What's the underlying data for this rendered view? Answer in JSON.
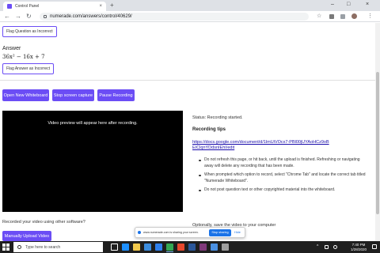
{
  "browser": {
    "tab_title": "Control Panel",
    "tab_close": "×",
    "new_tab": "+",
    "url": "numerade.com/answers/control/40629/",
    "window_controls": {
      "minimize": "–",
      "maximize": "□",
      "close": "×"
    },
    "nav": {
      "back": "←",
      "forward": "→",
      "reload": "↻"
    },
    "toolbar_icons": {
      "star": "☆",
      "menu": "⋮"
    }
  },
  "page": {
    "flag_question_label": "Flag Question as Incorrect",
    "answer_heading": "Answer",
    "answer_equation": "36x² − 16x + 7",
    "flag_answer_label": "Flag Answer as Incorrect",
    "buttons": {
      "open_whiteboard": "Open New Whiteboard",
      "stop_capture": "Stop screen capture",
      "pause_recording": "Pause Recording"
    },
    "video_placeholder": "Video preview will appear here after recording.",
    "status": "Status: Recording started.",
    "tips_heading": "Recording tips",
    "tips_link": "https://docs.google.com/document/d/1lmUiVOcx7-PBl00jUYAoHCz9oBEIClqnYDdsnIEhI/edit",
    "tips": [
      "Do not refresh this page, or hit back, until the upload is finished. Refreshing or navigating away will delete any recording that has been made.",
      "When prompted which option to record, select \"Chrome Tab\" and locate the correct tab titled \"Numerade Whiteboard\".",
      "Do not post question text or other copyrighted material into the whiteboard."
    ],
    "optional_save": "Optionally, save the video to your computer",
    "other_software_label": "Recorded your video using other software?",
    "manual_upload": "Manually Upload Video"
  },
  "share_bar": {
    "text": "www.numerade.com is sharing your screen.",
    "stop": "Stop sharing",
    "hide": "Hide"
  },
  "taskbar": {
    "search_placeholder": "Type here to search",
    "tray_caret": "^",
    "time": "7:40 PM",
    "date": "1/28/2020",
    "apps": [
      {
        "name": "task-view",
        "color": "#ffffff"
      },
      {
        "name": "edge",
        "color": "#1e90ff"
      },
      {
        "name": "explorer",
        "color": "#f2c94c"
      },
      {
        "name": "store",
        "color": "#3c8dde"
      },
      {
        "name": "mail",
        "color": "#2f80ed"
      },
      {
        "name": "chrome",
        "color": "#34a853"
      },
      {
        "name": "office",
        "color": "#e8492d"
      },
      {
        "name": "word",
        "color": "#2b579a"
      },
      {
        "name": "onenote",
        "color": "#80397b"
      },
      {
        "name": "photos",
        "color": "#4a90e2"
      },
      {
        "name": "app",
        "color": "#9e9e9e"
      }
    ]
  },
  "colors": {
    "accent": "#6b4df5",
    "link": "#1a0dab",
    "share_blue": "#1a73e8",
    "taskbar": "#1f1f1f"
  }
}
